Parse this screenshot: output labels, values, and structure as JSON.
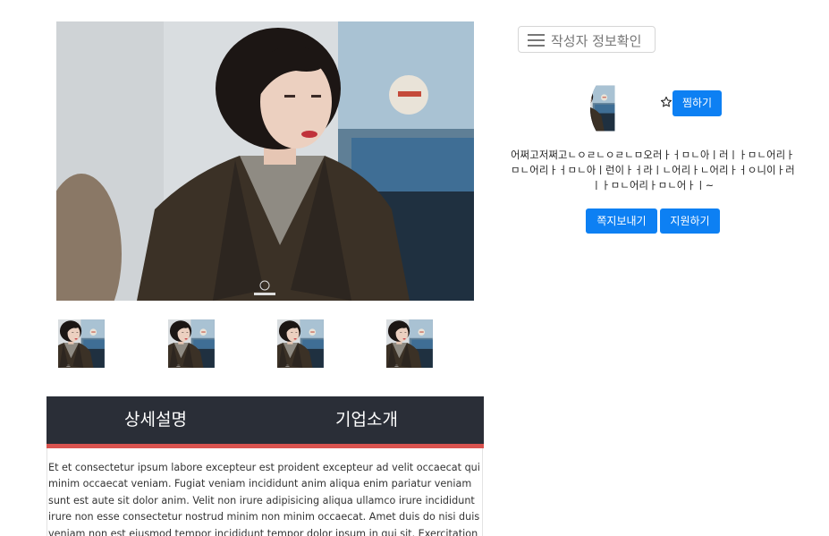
{
  "gallery": {
    "main_alt": "main product photo",
    "thumbnail_count": 4
  },
  "tabs": {
    "detail_label": "상세설명",
    "company_label": "기업소개",
    "accent_color": "#d9534f",
    "bar_color": "#2a2e37"
  },
  "description": {
    "text": "Et et consectetur ipsum labore excepteur est proident excepteur ad velit occaecat qui minim occaecat veniam. Fugiat veniam incididunt anim aliqua enim pariatur veniam sunt est aute sit dolor anim. Velit non irure adipisicing aliqua ullamco irure incididunt irure non esse consectetur nostrud minim non minim occaecat. Amet duis do nisi duis veniam non est eiusmod tempor incididunt tempor dolor ipsum in qui sit. Exercitation mollit sit culpa nisi"
  },
  "author": {
    "button_label": "작성자 정보확인",
    "menu_icon": "hamburger-menu-icon"
  },
  "profile": {
    "like_icon": "star-outline-icon",
    "like_label": "찜하기",
    "bio": "어쩌고저쩌고ㄴㅇㄹㄴㅇㄹㄴㅁ오러ㅏㅓㅁㄴ아ㅣ러ㅣㅏㅁㄴ어리ㅏㅁㄴ어리ㅏㅓㅁㄴ아ㅣ런이ㅏㅓ라ㅣㄴ어리ㅏㄴ어리ㅏㅓㅇ니이ㅏ러ㅣㅏㅁㄴ어리ㅏㅁㄴ어ㅏㅣ~",
    "message_label": "쪽지보내기",
    "apply_label": "지원하기",
    "button_color": "#0d80f3"
  }
}
